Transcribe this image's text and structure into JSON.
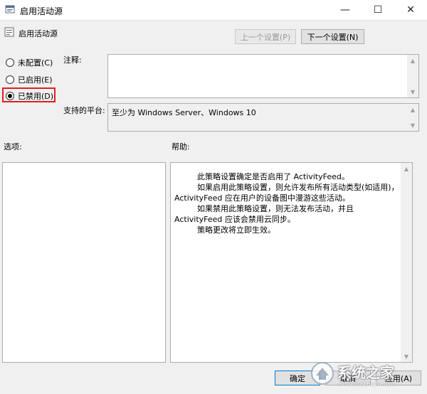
{
  "window": {
    "title": "启用活动源",
    "minimize_glyph": "—",
    "maximize_glyph": "☐",
    "close_glyph": "✕"
  },
  "header": {
    "policy_name": "启用活动源",
    "prev_setting_label": "上一个设置(P)",
    "next_setting_label": "下一个设置(N)"
  },
  "state_options": [
    {
      "label": "未配置(C)",
      "checked": false
    },
    {
      "label": "已启用(E)",
      "checked": false
    },
    {
      "label": "已禁用(D)",
      "checked": true
    }
  ],
  "comment": {
    "label": "注释:",
    "value": ""
  },
  "platform": {
    "label": "支持的平台:",
    "value": "至少为 Windows Server、Windows 10"
  },
  "options_label": "选项:",
  "help": {
    "label": "帮助:",
    "paragraphs": [
      "此策略设置确定是否启用了 ActivityFeed。",
      "如果启用此策略设置，则允许发布所有活动类型(如适用)，ActivityFeed 应在用户的设备图中漫游这些活动。",
      "如果禁用此策略设置，则无法发布活动，并且 ActivityFeed 应该会禁用云同步。",
      "策略更改将立即生效。"
    ]
  },
  "footer": {
    "ok_label": "确定",
    "cancel_label": "取消",
    "apply_label": "应用(A)"
  },
  "watermark": {
    "brand": "系统之家",
    "url": "XITONGZHIJIA.NET"
  },
  "colors": {
    "highlight": "#e02020",
    "accent": "#0078d7"
  }
}
